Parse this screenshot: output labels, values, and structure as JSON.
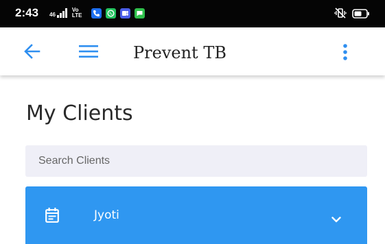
{
  "status_bar": {
    "time": "2:43",
    "signal_text": "46",
    "network_text": "Vo LTE",
    "icons": [
      "signal-icon",
      "volte-icon",
      "phone-app-icon",
      "whatsapp-icon",
      "teams-icon",
      "messages-icon",
      "vibrate-icon",
      "battery-icon"
    ],
    "colors": {
      "background": "#050505",
      "phone": "#1e6ff0",
      "whatsapp": "#22c35e",
      "teams": "#4a5ee8",
      "messages": "#2fc04c"
    }
  },
  "toolbar": {
    "title": "Prevent TB",
    "icons": [
      "back-arrow-icon",
      "menu-icon",
      "more-vert-icon"
    ],
    "accent_color": "#2f8ff0"
  },
  "page": {
    "title": "My Clients"
  },
  "search": {
    "placeholder": "Search Clients",
    "value": ""
  },
  "clients": [
    {
      "name": "Jyoti",
      "icon": "event-note-icon",
      "expand_icon": "chevron-down-icon",
      "color": "#2f97f1"
    }
  ]
}
